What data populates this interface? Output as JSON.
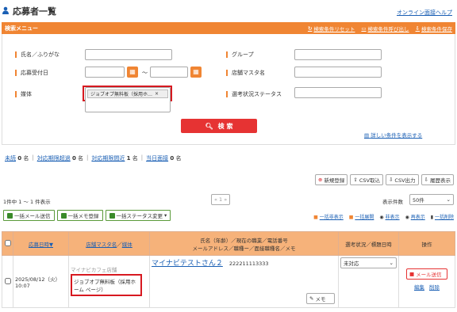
{
  "header": {
    "title": "応募者一覧",
    "help": "オンライン面接ヘルプ"
  },
  "search_bar": {
    "title": "検索メニュー",
    "reset": "検索条件リセット",
    "recall": "検索条件呼び出し",
    "save": "検索条件保存"
  },
  "form": {
    "name_label": "氏名／ふりがな",
    "date_label": "応募受付日",
    "date_sep": "～",
    "media_label": "媒体",
    "media_tag": "ジョブオプ無料板（採用ホ…",
    "group_label": "グループ",
    "store_label": "店舗マスタ名",
    "status_label": "選考状況ステータス",
    "search_button": "検 索",
    "detail_link": "詳しい条件を表示する"
  },
  "counts": [
    {
      "label": "未読",
      "value": "0",
      "unit": "名"
    },
    {
      "label": "対応期限超過",
      "value": "0",
      "unit": "名"
    },
    {
      "label": "対応期限間近",
      "value": "1",
      "unit": "名"
    },
    {
      "label": "当日面接",
      "value": "0",
      "unit": "名"
    }
  ],
  "tools": {
    "new": "新規登録",
    "csv_in": "CSV取込",
    "csv_out": "CSV出力",
    "history": "履歴表示"
  },
  "paging": {
    "summary": "1件中 1 ～ 1 件表示",
    "pager": "«  1  »",
    "per_page_label": "表示件数",
    "per_page": "50件"
  },
  "bulk": {
    "mail": "一括メール送信",
    "memo": "一括メモ登録",
    "status": "一括ステータス変更"
  },
  "view": {
    "collapse_all": "一括非表示",
    "expand_all": "一括展開",
    "hide": "非表示",
    "show": "再表示",
    "delete": "一括削除"
  },
  "table": {
    "h_date": "応募日時▼",
    "h_store": "店舗マスタ名",
    "h_media": "媒体",
    "h_name_1": "氏名（年齢）／現在の職業／電話番号",
    "h_name_2": "メールアドレス／職種ー／面接職種名／メモ",
    "h_status": "選考状況／標題日時",
    "h_ops": "操作",
    "row": {
      "date": "2025/08/12（火）",
      "time": "10:07",
      "store": "マイナビカフェ店舗",
      "media": "ジョブオプ無料板（採用ホーム ページ）",
      "name": "マイナビテストさん２",
      "phone": "222211113333",
      "status": "未対応",
      "memo": "メモ",
      "mail_btn": "メール送信",
      "edit": "編集",
      "delete": "削除"
    }
  },
  "colors": {
    "accent": "#f08533",
    "search": "#e63333",
    "highlight": "#d71920",
    "link": "#1a5fb4"
  }
}
